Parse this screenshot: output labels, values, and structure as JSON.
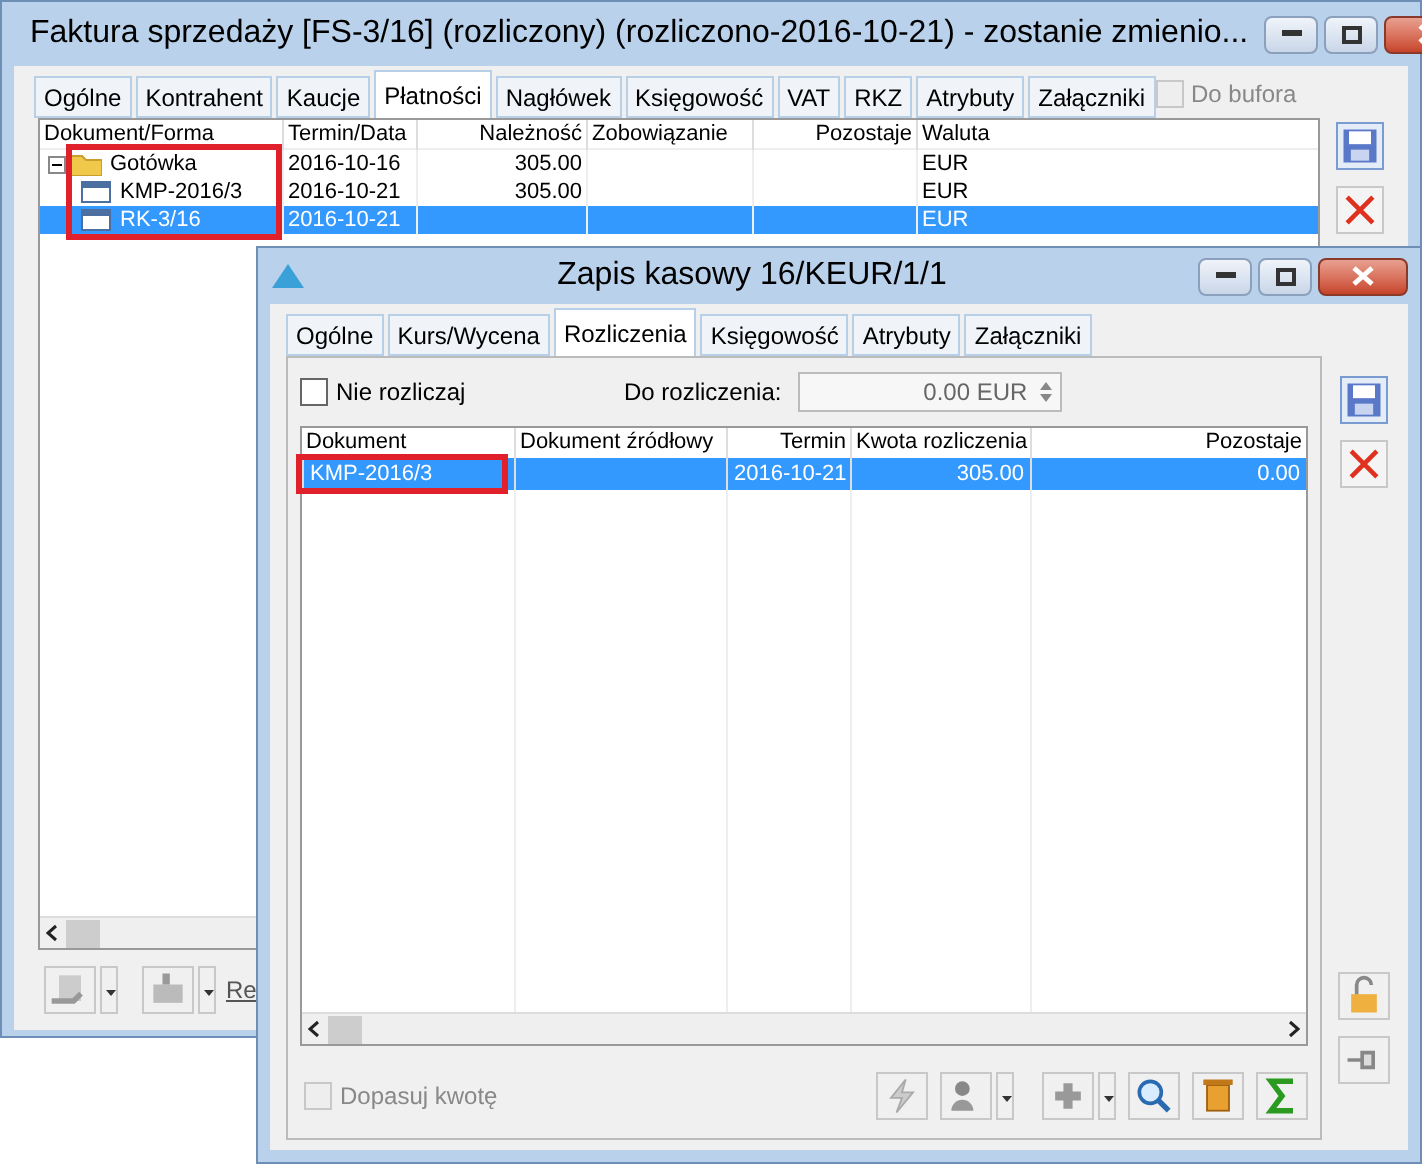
{
  "main_window": {
    "title": "Faktura sprzedaży [FS-3/16] (rozliczony) (rozliczono-2016-10-21) - zostanie zmienio...",
    "tabs": [
      {
        "label": "Ogólne",
        "selected": false
      },
      {
        "label": "Kontrahent",
        "selected": false
      },
      {
        "label": "Kaucje",
        "selected": false
      },
      {
        "label": "Płatności",
        "selected": true
      },
      {
        "label": "Nagłówek",
        "selected": false
      },
      {
        "label": "Księgowość",
        "selected": false
      },
      {
        "label": "VAT",
        "selected": false
      },
      {
        "label": "RKZ",
        "selected": false
      },
      {
        "label": "Atrybuty",
        "selected": false
      },
      {
        "label": "Załączniki",
        "selected": false
      }
    ],
    "do_bufora": {
      "label": "Do bufora",
      "checked": false,
      "disabled": true
    },
    "tree": {
      "columns": [
        "Dokument/Forma",
        "Termin/Data",
        "Należność",
        "Zobowiązanie",
        "Pozostaje",
        "Waluta"
      ],
      "highlighted": true,
      "items": [
        {
          "kind": "folder",
          "name": "Gotówka",
          "date": "2016-10-16",
          "amount": "305.00",
          "currency": "EUR",
          "expanded": true,
          "selected": false,
          "children": [
            {
              "kind": "document",
              "name": "KMP-2016/3",
              "date": "2016-10-21",
              "amount": "305.00",
              "currency": "EUR",
              "selected": false
            },
            {
              "kind": "document",
              "name": "RK-3/16",
              "date": "2016-10-21",
              "currency": "EUR",
              "selected": true
            }
          ]
        }
      ]
    },
    "footer_link": "Re"
  },
  "payment_window": {
    "title": "Zapis kasowy 16/KEUR/1/1",
    "tabs": [
      {
        "label": "Ogólne",
        "selected": false
      },
      {
        "label": "Kurs/Wycena",
        "selected": false
      },
      {
        "label": "Rozliczenia",
        "selected": true
      },
      {
        "label": "Księgowość",
        "selected": false
      },
      {
        "label": "Atrybuty",
        "selected": false
      },
      {
        "label": "Załączniki",
        "selected": false
      }
    ],
    "nie_rozliczaj": {
      "label": "Nie rozliczaj",
      "checked": false
    },
    "do_rozliczenia": {
      "label": "Do rozliczenia:",
      "value": "0.00 EUR"
    },
    "table": {
      "columns": [
        "Dokument",
        "Dokument źródłowy",
        "Termin",
        "Kwota rozliczenia",
        "Pozostaje"
      ],
      "rows": [
        {
          "cells": [
            "KMP-2016/3",
            "",
            "2016-10-21",
            "305.00",
            "0.00"
          ],
          "selected": true,
          "highlighted": true
        }
      ]
    },
    "dopasuj": {
      "label": "Dopasuj kwotę",
      "checked": false,
      "disabled": true
    }
  }
}
